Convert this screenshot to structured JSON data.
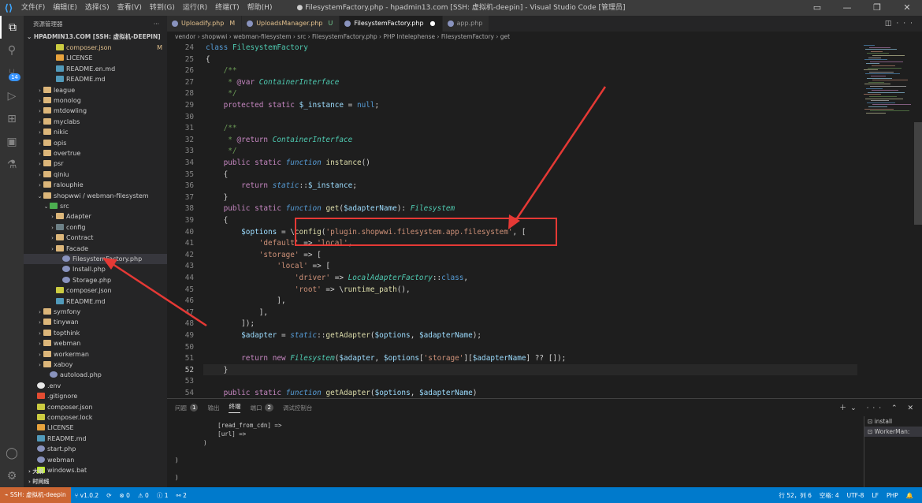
{
  "titlebar": {
    "menu": [
      "文件(F)",
      "编辑(E)",
      "选择(S)",
      "查看(V)",
      "转到(G)",
      "运行(R)",
      "终端(T)",
      "帮助(H)"
    ],
    "title": "● FilesystemFactory.php - hpadmin13.com [SSH: 虚拟机-deepin] - Visual Studio Code [管理员]"
  },
  "activity": {
    "badge": "14"
  },
  "sidebar": {
    "header": "资源管理器",
    "project": "HPADMIN13.COM [SSH: 虚拟机-DEEPIN]",
    "items": [
      {
        "label": "composer.json",
        "indent": 3,
        "icon": "fjson",
        "chevron": "",
        "color": "#e2c08d",
        "suffix": "M"
      },
      {
        "label": "LICENSE",
        "indent": 3,
        "icon": "flic",
        "chevron": ""
      },
      {
        "label": "README.en.md",
        "indent": 3,
        "icon": "fmd",
        "chevron": ""
      },
      {
        "label": "README.md",
        "indent": 3,
        "icon": "fmd",
        "chevron": ""
      },
      {
        "label": "league",
        "indent": 1,
        "icon": "fold",
        "chevron": "›"
      },
      {
        "label": "monolog",
        "indent": 1,
        "icon": "fold",
        "chevron": "›"
      },
      {
        "label": "mtdowling",
        "indent": 1,
        "icon": "fold",
        "chevron": "›"
      },
      {
        "label": "myclabs",
        "indent": 1,
        "icon": "fold",
        "chevron": "›"
      },
      {
        "label": "nikic",
        "indent": 1,
        "icon": "fold",
        "chevron": "›"
      },
      {
        "label": "opis",
        "indent": 1,
        "icon": "fold",
        "chevron": "›"
      },
      {
        "label": "overtrue",
        "indent": 1,
        "icon": "fold",
        "chevron": "›"
      },
      {
        "label": "psr",
        "indent": 1,
        "icon": "fold",
        "chevron": "›"
      },
      {
        "label": "qiniu",
        "indent": 1,
        "icon": "fold",
        "chevron": "›"
      },
      {
        "label": "ralouphie",
        "indent": 1,
        "icon": "fold",
        "chevron": "›"
      },
      {
        "label": "shopwwi / webman-filesystem",
        "indent": 1,
        "icon": "fold-o",
        "chevron": "⌄"
      },
      {
        "label": "src",
        "indent": 2,
        "icon": "fsrc",
        "chevron": "⌄"
      },
      {
        "label": "Adapter",
        "indent": 3,
        "icon": "fold",
        "chevron": "›"
      },
      {
        "label": "config",
        "indent": 3,
        "icon": "fcfg",
        "chevron": "›"
      },
      {
        "label": "Contract",
        "indent": 3,
        "icon": "fold",
        "chevron": "›"
      },
      {
        "label": "Facade",
        "indent": 3,
        "icon": "fold",
        "chevron": "›"
      },
      {
        "label": "FilesystemFactory.php",
        "indent": 4,
        "icon": "fphp",
        "chevron": "",
        "selected": true
      },
      {
        "label": "Install.php",
        "indent": 4,
        "icon": "fphp",
        "chevron": ""
      },
      {
        "label": "Storage.php",
        "indent": 4,
        "icon": "fphp",
        "chevron": ""
      },
      {
        "label": "composer.json",
        "indent": 3,
        "icon": "fjson",
        "chevron": ""
      },
      {
        "label": "README.md",
        "indent": 3,
        "icon": "fmd",
        "chevron": ""
      },
      {
        "label": "symfony",
        "indent": 1,
        "icon": "fold",
        "chevron": "›"
      },
      {
        "label": "tinywan",
        "indent": 1,
        "icon": "fold",
        "chevron": "›"
      },
      {
        "label": "topthink",
        "indent": 1,
        "icon": "fold",
        "chevron": "›"
      },
      {
        "label": "webman",
        "indent": 1,
        "icon": "fold",
        "chevron": "›"
      },
      {
        "label": "workerman",
        "indent": 1,
        "icon": "fold",
        "chevron": "›"
      },
      {
        "label": "xaboy",
        "indent": 1,
        "icon": "fold",
        "chevron": "›"
      },
      {
        "label": "autoload.php",
        "indent": 2,
        "icon": "fphp",
        "chevron": ""
      },
      {
        "label": ".env",
        "indent": 0,
        "icon": "fenv",
        "chevron": ""
      },
      {
        "label": ".gitignore",
        "indent": 0,
        "icon": "fgit",
        "chevron": ""
      },
      {
        "label": "composer.json",
        "indent": 0,
        "icon": "fjson",
        "chevron": ""
      },
      {
        "label": "composer.lock",
        "indent": 0,
        "icon": "flock",
        "chevron": ""
      },
      {
        "label": "LICENSE",
        "indent": 0,
        "icon": "flic",
        "chevron": ""
      },
      {
        "label": "README.md",
        "indent": 0,
        "icon": "fmd",
        "chevron": ""
      },
      {
        "label": "start.php",
        "indent": 0,
        "icon": "fphp",
        "chevron": ""
      },
      {
        "label": "webman",
        "indent": 0,
        "icon": "fphp",
        "chevron": ""
      },
      {
        "label": "windows.bat",
        "indent": 0,
        "icon": "fbat",
        "chevron": ""
      }
    ],
    "outline_label": "大纲",
    "timeline_label": "时间线"
  },
  "tabs": [
    {
      "label": "Uploadify.php",
      "flag": "M",
      "flag_class": "mod",
      "active": false
    },
    {
      "label": "UploadsManager.php",
      "flag": "U",
      "flag_class": "un",
      "active": false
    },
    {
      "label": "FilesystemFactory.php",
      "flag": "●",
      "flag_class": "dot",
      "active": true
    },
    {
      "label": "app.php",
      "flag": "",
      "flag_class": "",
      "active": false
    }
  ],
  "breadcrumb": "vendor › shopwwi › webman-filesystem › src › FilesystemFactory.php › PHP Intelephense › FilesystemFactory › get",
  "editor": {
    "current_line": "52",
    "lines": [
      {
        "n": "24",
        "h": "<span class='kb'>class</span> <span class='cls'>FilesystemFactory</span>"
      },
      {
        "n": "25",
        "h": "{"
      },
      {
        "n": "26",
        "h": "    <span class='cm'>/**</span>"
      },
      {
        "n": "27",
        "h": "    <span class='cm'> * </span><span class='k'>@var</span> <span class='cls'><i>ContainerInterface</i></span>"
      },
      {
        "n": "28",
        "h": "    <span class='cm'> */</span>"
      },
      {
        "n": "29",
        "h": "    <span class='k'>protected</span> <span class='k'>static</span> <span class='v'>$_instance</span> = <span class='kb'>null</span>;"
      },
      {
        "n": "30",
        "h": ""
      },
      {
        "n": "31",
        "h": "    <span class='cm'>/**</span>"
      },
      {
        "n": "32",
        "h": "    <span class='cm'> * </span><span class='k'>@return</span> <span class='cls'><i>ContainerInterface</i></span>"
      },
      {
        "n": "33",
        "h": "    <span class='cm'> */</span>"
      },
      {
        "n": "34",
        "h": "    <span class='k'>public</span> <span class='k'>static</span> <span class='kb'><i>function</i></span> <span class='fn'>instance</span>()"
      },
      {
        "n": "35",
        "h": "    {"
      },
      {
        "n": "36",
        "h": "        <span class='k'>return</span> <span class='kb'><i>static</i></span>::<span class='v'>$_instance</span>;"
      },
      {
        "n": "37",
        "h": "    }"
      },
      {
        "n": "38",
        "h": "    <span class='k'>public</span> <span class='k'>static</span> <span class='kb'><i>function</i></span> <span class='fn'>get</span>(<span class='v'>$adapterName</span>): <span class='cls'><i>Filesystem</i></span>"
      },
      {
        "n": "39",
        "h": "    {"
      },
      {
        "n": "40",
        "h": "        <span class='v'>$options</span> = \\<span class='fn'>config</span>(<span class='str'>'plugin.shopwwi.filesystem.app.filesystem'</span>, ["
      },
      {
        "n": "41",
        "h": "            <span class='str'>'default'</span> => <span class='str'>'local'</span>,"
      },
      {
        "n": "42",
        "h": "            <span class='str'>'storage'</span> => ["
      },
      {
        "n": "43",
        "h": "                <span class='str'>'local'</span> => ["
      },
      {
        "n": "44",
        "h": "                    <span class='str'>'driver'</span> => <span class='cls'><i>LocalAdapterFactory</i></span>::<span class='kb'>class</span>,"
      },
      {
        "n": "45",
        "h": "                    <span class='str'>'root'</span> => \\<span class='fn'>runtime_path</span>(),"
      },
      {
        "n": "46",
        "h": "                ],"
      },
      {
        "n": "47",
        "h": "            ],"
      },
      {
        "n": "48",
        "h": "        ]);"
      },
      {
        "n": "49",
        "h": "        <span class='v'>$adapter</span> = <span class='kb'><i>static</i></span>::<span class='fn'>getAdapter</span>(<span class='v'>$options</span>, <span class='v'>$adapterName</span>);"
      },
      {
        "n": "50",
        "h": ""
      },
      {
        "n": "51",
        "h": "        <span class='k'>return</span> <span class='k'>new</span> <span class='cls'><i>Filesystem</i></span>(<span class='v'>$adapter</span>, <span class='v'>$options</span>[<span class='str'>'storage'</span>][<span class='v'>$adapterName</span>] ?? []);"
      },
      {
        "n": "52",
        "h": "    }"
      },
      {
        "n": "53",
        "h": ""
      },
      {
        "n": "54",
        "h": "    <span class='k'>public</span> <span class='k'>static</span> <span class='kb'><i>function</i></span> <span class='fn'>getAdapter</span>(<span class='v'>$options</span>, <span class='v'>$adapterName</span>)"
      }
    ]
  },
  "panel": {
    "tabs": [
      {
        "label": "问题",
        "count": "1",
        "active": false
      },
      {
        "label": "输出",
        "count": "",
        "active": false
      },
      {
        "label": "终端",
        "count": "",
        "active": true
      },
      {
        "label": "端口",
        "count": "2",
        "active": false
      },
      {
        "label": "调试控制台",
        "count": "",
        "active": false
      }
    ],
    "terminal_text": "            [read_from_cdn] =>\n            [url] =>\n        )\n\n)\n\n)\n",
    "terminals": [
      {
        "label": "install",
        "active": false
      },
      {
        "label": "WorkerMan:",
        "active": true
      }
    ]
  },
  "status": {
    "remote": "SSH: 虚拟机-deepin",
    "branch": "v1.0.2",
    "sync": "⟳",
    "errors": "⊗ 0",
    "warnings": "⚠ 0",
    "info": "ⓘ 1",
    "ports": "⚯ 2",
    "position": "行 52，列 6",
    "spaces": "空格: 4",
    "encoding": "UTF-8",
    "eol": "LF",
    "language": "PHP"
  },
  "colors": {
    "accent": "#007acc",
    "annotation": "#e53935",
    "remote": "#cc6633"
  }
}
